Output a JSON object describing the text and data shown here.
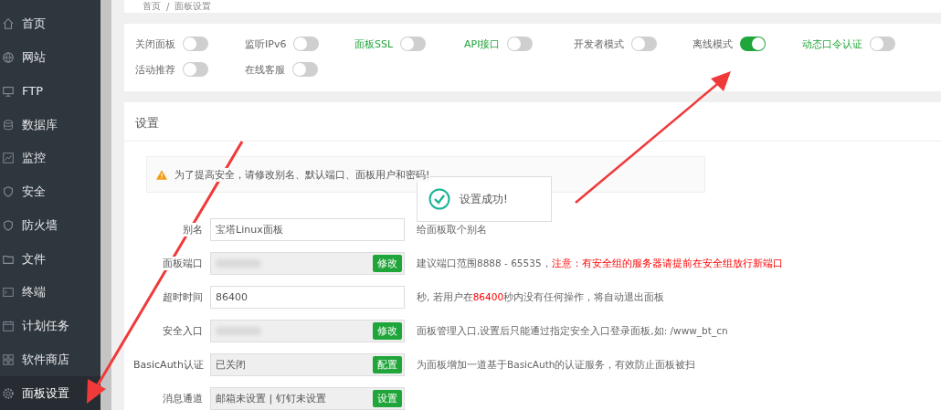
{
  "sidebar": {
    "items": [
      {
        "label": "首页",
        "selected": false
      },
      {
        "label": "网站",
        "selected": false
      },
      {
        "label": "FTP",
        "selected": false
      },
      {
        "label": "数据库",
        "selected": false
      },
      {
        "label": "监控",
        "selected": false
      },
      {
        "label": "安全",
        "selected": false
      },
      {
        "label": "防火墙",
        "selected": false
      },
      {
        "label": "文件",
        "selected": false
      },
      {
        "label": "终端",
        "selected": false
      },
      {
        "label": "计划任务",
        "selected": false
      },
      {
        "label": "软件商店",
        "selected": false
      },
      {
        "label": "面板设置",
        "selected": true
      }
    ]
  },
  "breadcrumb": [
    "首页",
    "/",
    "面板设置"
  ],
  "toggles": [
    {
      "label": "关闭面板",
      "emphasis": false,
      "on": false
    },
    {
      "label": "监听IPv6",
      "emphasis": false,
      "on": false
    },
    {
      "label": "面板SSL",
      "emphasis": true,
      "on": false
    },
    {
      "label": "API接口",
      "emphasis": true,
      "on": false
    },
    {
      "label": "开发者模式",
      "emphasis": false,
      "on": false
    },
    {
      "label": "离线模式",
      "emphasis": false,
      "on": true
    },
    {
      "label": "动态口令认证",
      "emphasis": true,
      "on": false
    },
    {
      "label": "活动推荐",
      "emphasis": false,
      "on": false
    },
    {
      "label": "在线客服",
      "emphasis": false,
      "on": false
    }
  ],
  "settings": {
    "title": "设置",
    "warning": "为了提高安全，请修改别名、默认端口、面板用户和密码!",
    "rows": [
      {
        "label": "别名",
        "kind": "input",
        "value": "宝塔Linux面板",
        "hint": [
          {
            "text": " 给面板取个别名",
            "alert": false
          }
        ]
      },
      {
        "label": "面板端口",
        "kind": "masked-action",
        "button": "修改",
        "hint": [
          {
            "text": "建议端口范围8888 - 65535，",
            "alert": false
          },
          {
            "text": "注意：有安全组的服务器请提前在安全组放行新端口",
            "alert": true
          }
        ]
      },
      {
        "label": "超时时间",
        "kind": "input",
        "value": "86400",
        "hint": [
          {
            "text": " 秒, 若用户在",
            "alert": false
          },
          {
            "text": "86400",
            "alert": true
          },
          {
            "text": "秒内没有任何操作，将自动退出面板",
            "alert": false
          }
        ]
      },
      {
        "label": "安全入口",
        "kind": "masked-action",
        "button": "修改",
        "hint": [
          {
            "text": "面板管理入口,设置后只能通过指定安全入口登录面板,如: /www_bt_cn",
            "alert": false
          }
        ]
      },
      {
        "label": "BasicAuth认证",
        "kind": "action",
        "value": "已关闭",
        "button": "配置",
        "hint": [
          {
            "text": "为面板增加一道基于BasicAuth的认证服务，有效防止面板被扫",
            "alert": false
          }
        ]
      },
      {
        "label": "消息通道",
        "kind": "action",
        "value": "邮箱未设置 | 钉钉未设置",
        "button": "设置",
        "hint": []
      }
    ]
  },
  "toast": {
    "message": "设置成功!"
  }
}
